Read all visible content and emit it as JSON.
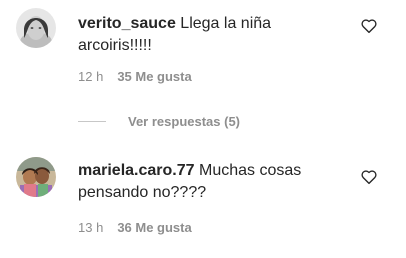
{
  "comments": [
    {
      "username": "verito_sauce",
      "text": "Llega la niña arcoiris!!!!!",
      "time": "12 h",
      "likes": "35 Me gusta",
      "avatar_icon": "grayscale-portrait-avatar",
      "heart_icon": "heart-outline-icon"
    },
    {
      "username": "mariela.caro.77",
      "text": "Muchas cosas pensando no????",
      "time": "13 h",
      "likes": "36 Me gusta",
      "avatar_icon": "color-photo-avatar",
      "heart_icon": "heart-outline-icon"
    }
  ],
  "replies": {
    "label": "Ver respuestas (5)"
  },
  "colors": {
    "primary_text": "#262626",
    "secondary_text": "#8e8e8e",
    "divider": "#c7c7c7"
  }
}
